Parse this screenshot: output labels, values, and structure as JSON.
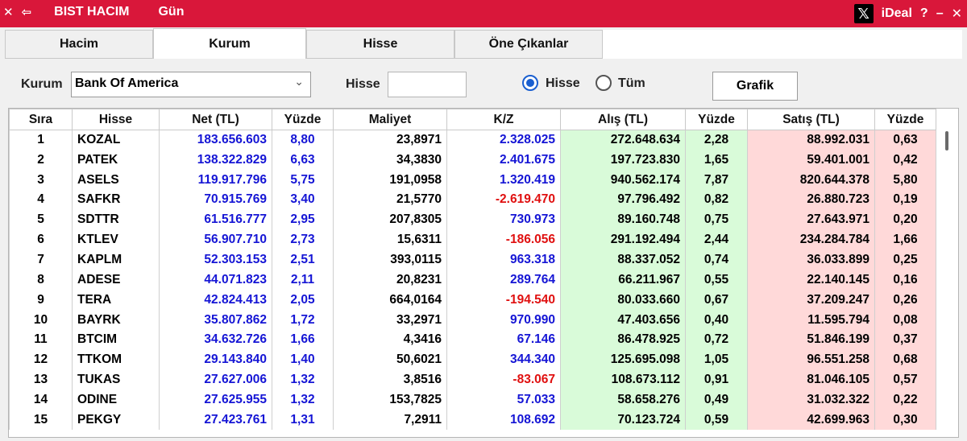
{
  "window": {
    "title": "BIST HACIM",
    "period": "Gün",
    "brand": "iDeal",
    "help": "?",
    "minimize": "–",
    "close": "✕",
    "back": "⇦",
    "menu_close": "✕",
    "x_logo": "𝕏"
  },
  "tabs": [
    {
      "label": "Hacim",
      "active": false
    },
    {
      "label": "Kurum",
      "active": true
    },
    {
      "label": "Hisse",
      "active": false
    },
    {
      "label": "Öne Çıkanlar",
      "active": false
    }
  ],
  "filters": {
    "kurum_label": "Kurum",
    "kurum_value": "Bank Of America",
    "hisse_label": "Hisse",
    "hisse_value": "",
    "radio_hisse": "Hisse",
    "radio_tum": "Tüm",
    "selected_radio": "Hisse",
    "grafik_button": "Grafik"
  },
  "table": {
    "columns": [
      "Sıra",
      "Hisse",
      "Net (TL)",
      "Yüzde",
      "Maliyet",
      "K/Z",
      "Alış (TL)",
      "Yüzde",
      "Satış (TL)",
      "Yüzde"
    ],
    "rows": [
      [
        "1",
        "KOZAL",
        "183.656.603",
        "8,80",
        "23,8971",
        "2.328.025",
        "272.648.634",
        "2,28",
        "88.992.031",
        "0,63"
      ],
      [
        "2",
        "PATEK",
        "138.322.829",
        "6,63",
        "34,3830",
        "2.401.675",
        "197.723.830",
        "1,65",
        "59.401.001",
        "0,42"
      ],
      [
        "3",
        "ASELS",
        "119.917.796",
        "5,75",
        "191,0958",
        "1.320.419",
        "940.562.174",
        "7,87",
        "820.644.378",
        "5,80"
      ],
      [
        "4",
        "SAFKR",
        "70.915.769",
        "3,40",
        "21,5770",
        "-2.619.470",
        "97.796.492",
        "0,82",
        "26.880.723",
        "0,19"
      ],
      [
        "5",
        "SDTTR",
        "61.516.777",
        "2,95",
        "207,8305",
        "730.973",
        "89.160.748",
        "0,75",
        "27.643.971",
        "0,20"
      ],
      [
        "6",
        "KTLEV",
        "56.907.710",
        "2,73",
        "15,6311",
        "-186.056",
        "291.192.494",
        "2,44",
        "234.284.784",
        "1,66"
      ],
      [
        "7",
        "KAPLM",
        "52.303.153",
        "2,51",
        "393,0115",
        "963.318",
        "88.337.052",
        "0,74",
        "36.033.899",
        "0,25"
      ],
      [
        "8",
        "ADESE",
        "44.071.823",
        "2,11",
        "20,8231",
        "289.764",
        "66.211.967",
        "0,55",
        "22.140.145",
        "0,16"
      ],
      [
        "9",
        "TERA",
        "42.824.413",
        "2,05",
        "664,0164",
        "-194.540",
        "80.033.660",
        "0,67",
        "37.209.247",
        "0,26"
      ],
      [
        "10",
        "BAYRK",
        "35.807.862",
        "1,72",
        "33,2971",
        "970.990",
        "47.403.656",
        "0,40",
        "11.595.794",
        "0,08"
      ],
      [
        "11",
        "BTCIM",
        "34.632.726",
        "1,66",
        "4,3416",
        "67.146",
        "86.478.925",
        "0,72",
        "51.846.199",
        "0,37"
      ],
      [
        "12",
        "TTKOM",
        "29.143.840",
        "1,40",
        "50,6021",
        "344.340",
        "125.695.098",
        "1,05",
        "96.551.258",
        "0,68"
      ],
      [
        "13",
        "TUKAS",
        "27.627.006",
        "1,32",
        "3,8516",
        "-83.067",
        "108.673.112",
        "0,91",
        "81.046.105",
        "0,57"
      ],
      [
        "14",
        "ODINE",
        "27.625.955",
        "1,32",
        "153,7825",
        "57.033",
        "58.658.276",
        "0,49",
        "31.032.322",
        "0,22"
      ],
      [
        "15",
        "PEKGY",
        "27.423.761",
        "1,31",
        "7,2911",
        "108.692",
        "70.123.724",
        "0,59",
        "42.699.963",
        "0,30"
      ]
    ]
  },
  "colors": {
    "titlebar": "#d9173a",
    "positive_text": "#1515d5",
    "negative_text": "#e01010",
    "buy_bg": "#d9fbd9",
    "sell_bg": "#ffd9d9"
  }
}
